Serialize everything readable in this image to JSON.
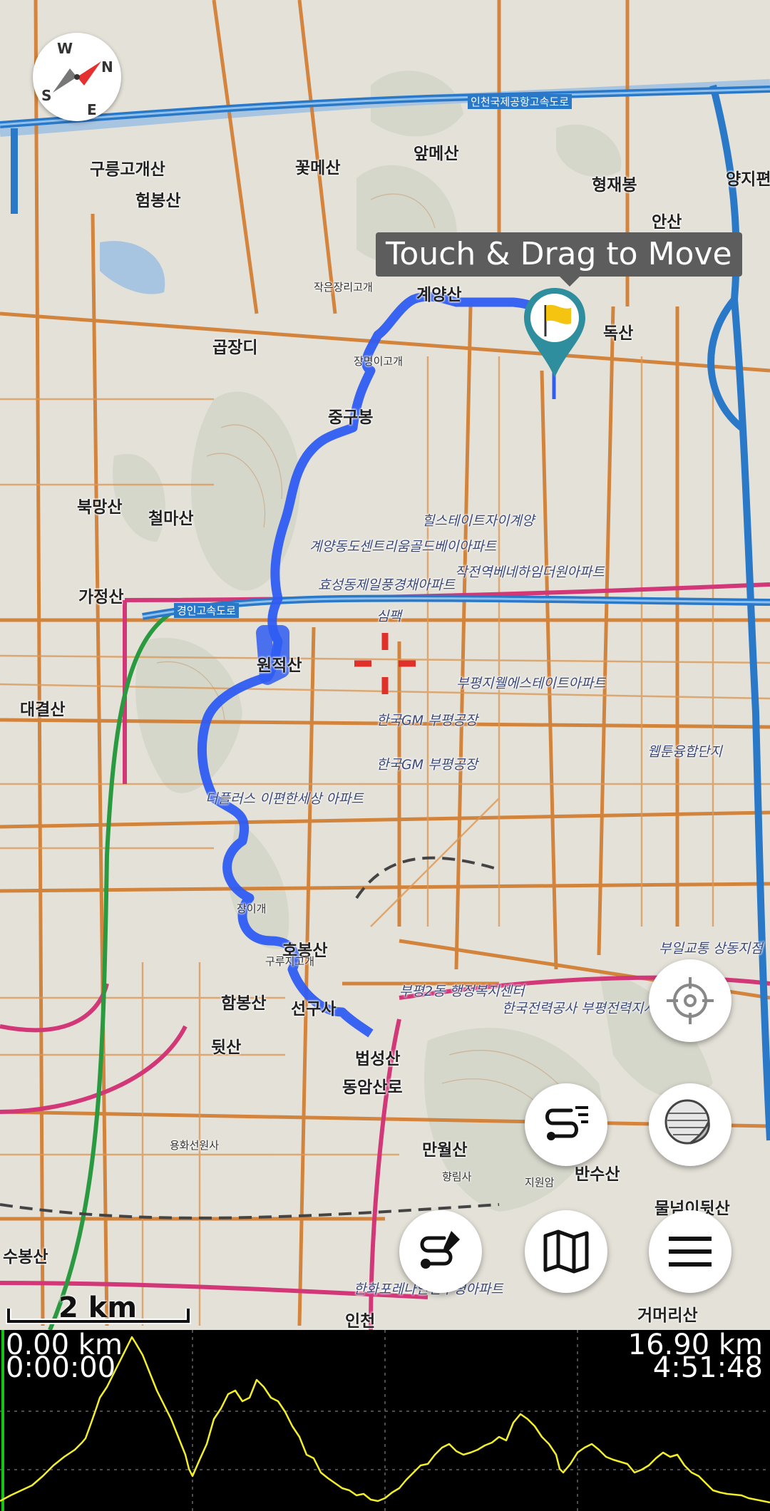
{
  "map": {
    "tooltip": "Touch & Drag to Move",
    "scale_label": "2 km",
    "compass": {
      "n": "N",
      "s": "S",
      "e": "E",
      "w": "W"
    },
    "labels": {
      "gureung": "구릉고개산",
      "heombong": "험봉산",
      "kkotmae": "꽃메산",
      "apme": "앞메산",
      "hyeongjae": "형재봉",
      "ansan": "안산",
      "yangji": "양지편",
      "gyeyang": "계양산",
      "doksan": "독산",
      "gopjangdi": "곱장디",
      "jungbong": "중구봉",
      "bukmang": "북망산",
      "cheolma": "철마산",
      "gajeong": "가정산",
      "wonjeok": "원적산",
      "daegyeol": "대결산",
      "hambong": "함봉산",
      "sunsaan": "선구사",
      "hobongsan": "호봉산",
      "teutsan": "뒷산",
      "beopseong": "법성산",
      "dongamsan": "동암산로",
      "manwol": "만월산",
      "bansu": "반수산",
      "mulnomi": "물넘이뒷산",
      "sububong": "수봉산",
      "geomeori": "거머리산",
      "incheon": "인천",
      "hillstate": "힐스테이트자이계양",
      "centreville": "계양동도센트리움골드베이아파트",
      "jakjeon": "작전역베네하임더원아파트",
      "hyoseong": "효성동제일풍경채아파트",
      "bupyeong_apt": "부평지웰에스테이트아파트",
      "gm1": "한국GM 부평공장",
      "gm2": "한국GM 부평공장",
      "deoplus": "더플러스 이편한세상 아파트",
      "kepco": "한국전력공사 부평전력지사",
      "hwanwha": "한화포레나인천부평아파트",
      "haengjeong": "부평2동 행정복지센터",
      "webtoon": "웹툰융합단지",
      "bupyeong_market": "부일교통 상동지점",
      "airport_rd": "인천국제공항고속도로",
      "gyeongin_rd": "경인고속도로",
      "simbaek": "심팩",
      "yongseon": "용화선원사",
      "jiwon": "지원암",
      "hyangrim": "향림사",
      "gyeyang_ridge": "작은장리고개",
      "jangmyeong": "장명이고개",
      "guruk": "구루지고개",
      "jangi": "장이개"
    }
  },
  "buttons": {
    "locate": "crosshair-icon",
    "track": "route-list-icon",
    "layers": "layers-icon",
    "draw": "route-edit-icon",
    "maps": "map-icon",
    "menu": "menu-icon"
  },
  "profile": {
    "distance_start": "0.00 km",
    "time_start": "0:00:00",
    "distance_end": "16.90 km",
    "time_end": "4:51:48",
    "line_color": "#f2ee2a",
    "cursor_color": "#18c018"
  },
  "colors": {
    "track": "#2f5cf2",
    "highway": "#2a78c8",
    "road": "#d27a2c",
    "main_road": "#d23878",
    "pin": "#2e8e9e"
  }
}
